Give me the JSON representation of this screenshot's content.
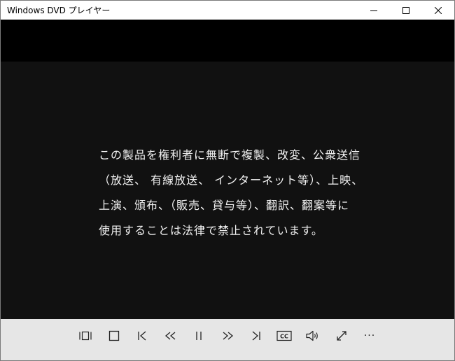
{
  "window": {
    "title": "Windows DVD プレイヤー"
  },
  "video": {
    "notice_lines": [
      "この製品を権利者に無断で複製、改変、公衆送信",
      "（放送、 有線放送、 インターネット等）、上映、",
      "上演、頒布、（販売、貸与等）、翻訳、翻案等に",
      "使用することは法律で禁止されています。"
    ]
  },
  "controls": {
    "items": [
      {
        "name": "menu-button",
        "icon": "menu-icon"
      },
      {
        "name": "stop-button",
        "icon": "stop-icon"
      },
      {
        "name": "previous-chapter-button",
        "icon": "skip-back-icon"
      },
      {
        "name": "rewind-button",
        "icon": "rewind-icon"
      },
      {
        "name": "pause-button",
        "icon": "pause-icon"
      },
      {
        "name": "fast-forward-button",
        "icon": "fast-forward-icon"
      },
      {
        "name": "next-chapter-button",
        "icon": "skip-forward-icon"
      },
      {
        "name": "closed-captions-button",
        "icon": "cc-icon"
      },
      {
        "name": "volume-button",
        "icon": "volume-icon"
      },
      {
        "name": "fullscreen-button",
        "icon": "fullscreen-icon"
      },
      {
        "name": "more-options-button",
        "icon": "more-icon"
      }
    ],
    "cc_label": "CC",
    "more_label": "···"
  }
}
